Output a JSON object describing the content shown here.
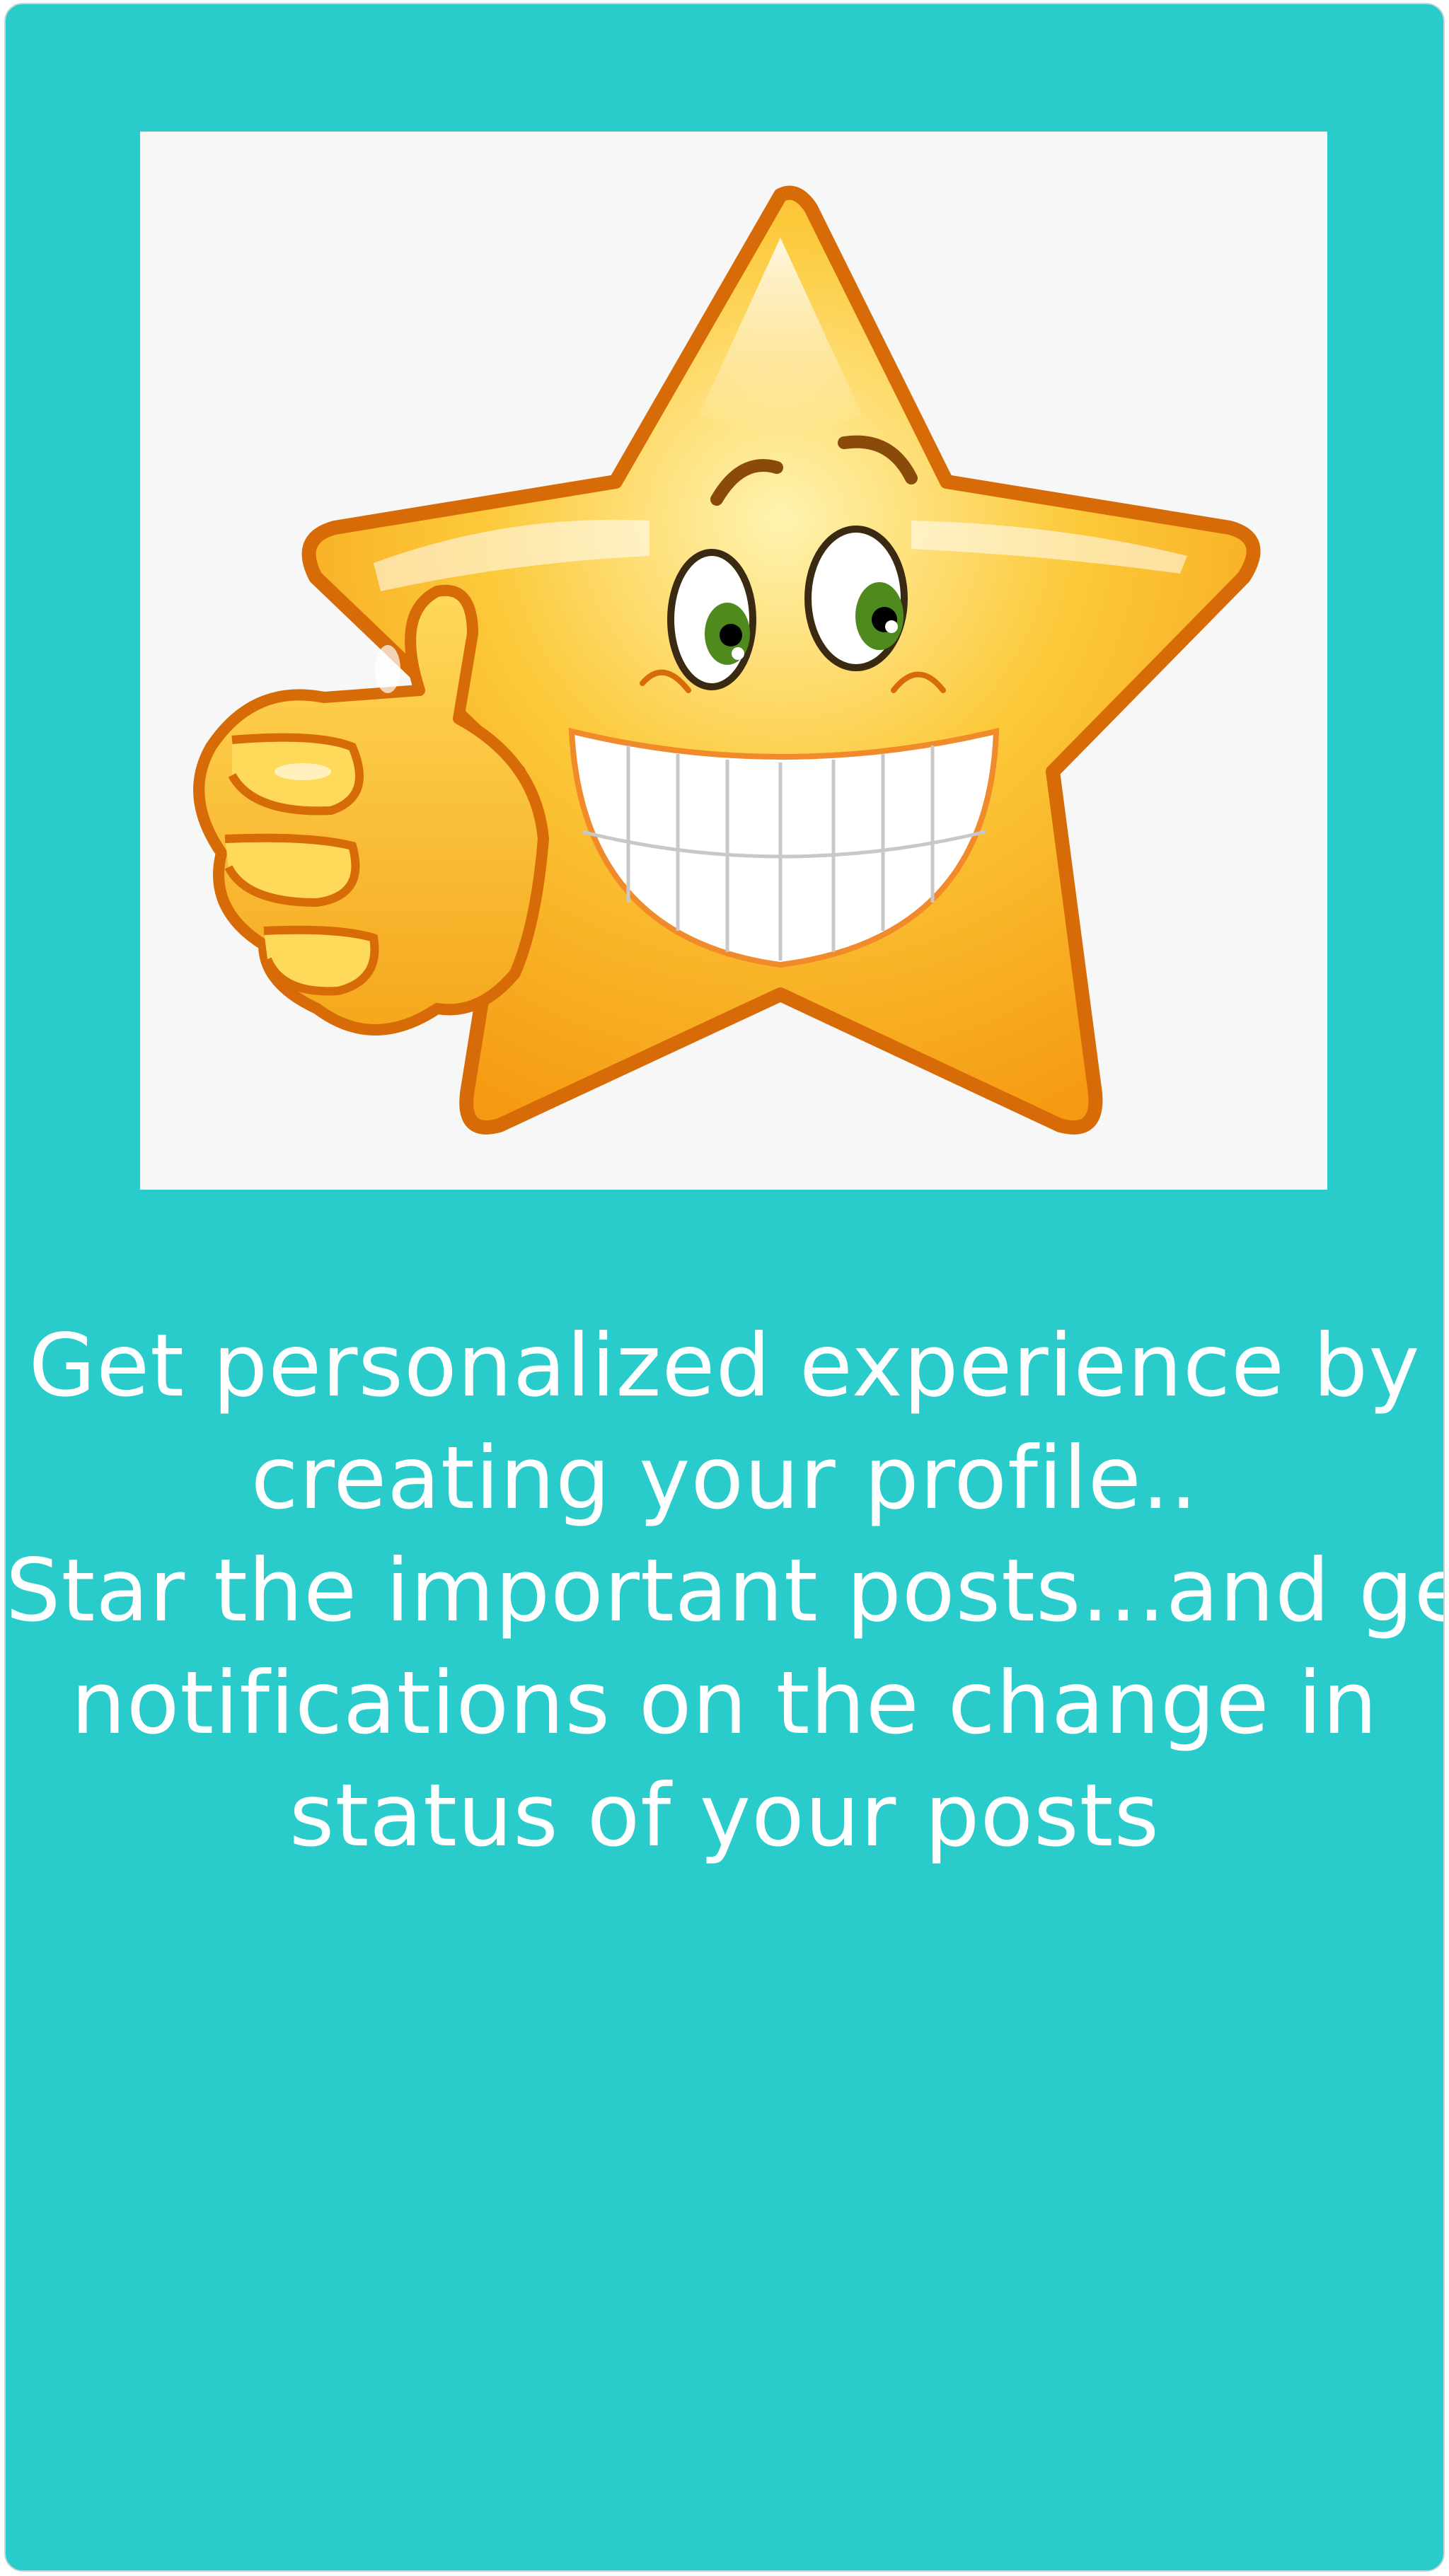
{
  "onboarding": {
    "illustration": {
      "icon": "smiling-star-thumbs-up-icon",
      "background": "#f7f7f7"
    },
    "message": {
      "line_1": "Get personalized experience by",
      "line_2": "creating your profile..",
      "line_3": "Star the important posts...and get",
      "line_4": "notifications on the change in",
      "line_5": "status of your posts"
    },
    "colors": {
      "background": "#29cbcb",
      "text": "#ffffff",
      "star": "#fbbf24",
      "star_outline": "#d96d0a"
    }
  }
}
